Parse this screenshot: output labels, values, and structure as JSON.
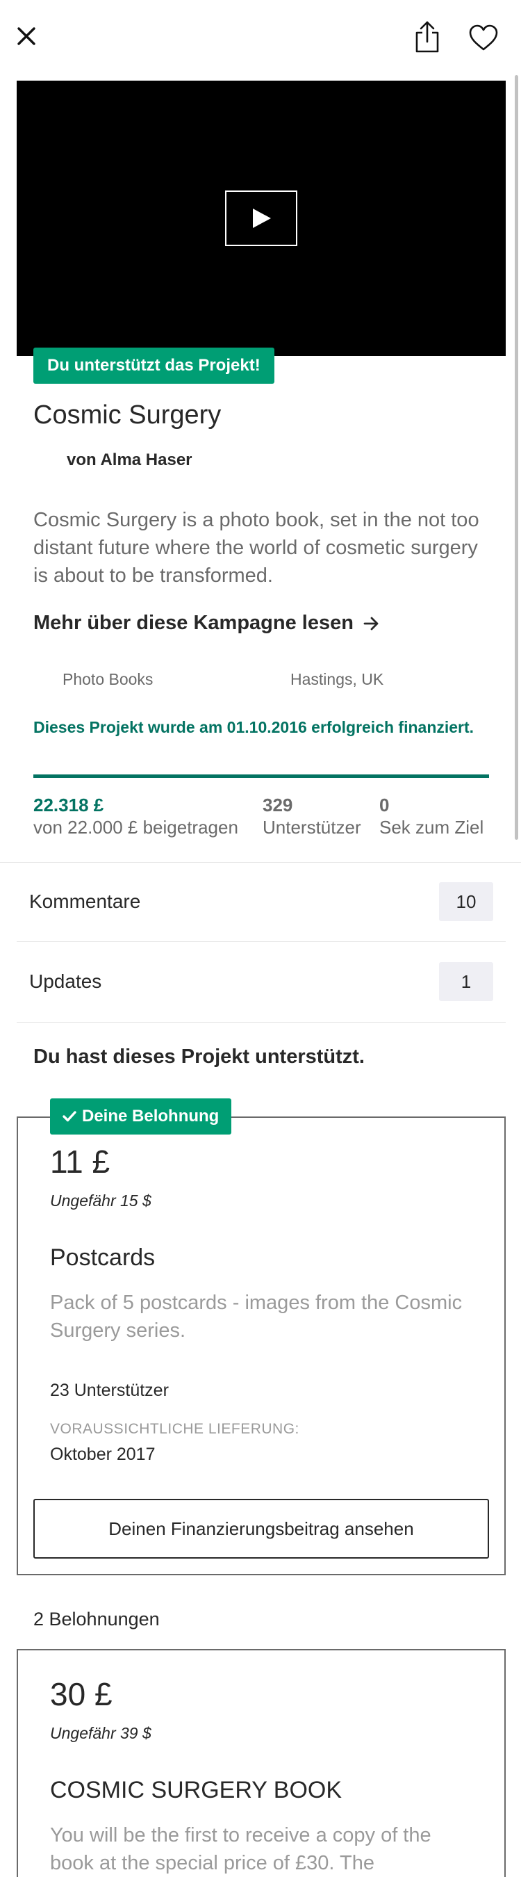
{
  "project": {
    "backed_badge": "Du unterstützt das Projekt!",
    "title": "Cosmic Surgery",
    "creator": "von Alma Haser",
    "blurb": "Cosmic Surgery is a photo book, set in the not too distant future where the world of cosmetic surgery is about to be transformed.",
    "read_more": "Mehr über diese Kampagne lesen",
    "category": "Photo Books",
    "location": "Hastings, UK",
    "funded_message": "Dieses Projekt wurde am 01.10.2016 erfolgreich finanziert.",
    "progress_fraction": 1.0,
    "stats": {
      "pledged_value": "22.318 £",
      "pledged_label": "von 22.000 £ beigetragen",
      "backers_value": "329",
      "backers_label": "Unterstützer",
      "time_value": "0",
      "time_label": "Sek zum Ziel"
    }
  },
  "nav": {
    "comments_label": "Kommentare",
    "comments_count": "10",
    "updates_label": "Updates",
    "updates_count": "1"
  },
  "backed_section": {
    "heading": "Du hast dieses Projekt unterstützt.",
    "badge": "Deine Belohnung",
    "reward": {
      "price": "11 £",
      "approx": "Ungefähr 15 $",
      "title": "Postcards",
      "description": "Pack of 5 postcards - images from the Cosmic Surgery series.",
      "backers": "23 Unterstützer",
      "estimated_label": "VORAUSSICHTLICHE LIEFERUNG:",
      "estimated_value": "Oktober 2017"
    },
    "view_pledge_button": "Deinen Finanzierungsbeitrag ansehen"
  },
  "rewards": {
    "count_label": "2 Belohnungen",
    "items": [
      {
        "price": "30 £",
        "approx": "Ungefähr 39 $",
        "title": "COSMIC SURGERY BOOK",
        "description": "You will be the first to receive a copy of the book at the special price of £30. The"
      }
    ]
  },
  "colors": {
    "accent_green": "#009e74",
    "dark_green": "#037362",
    "text_primary": "#282828",
    "text_secondary": "#6a6a6a"
  },
  "icons": [
    "close-icon",
    "share-icon",
    "heart-icon",
    "play-icon",
    "arrow-right-icon",
    "checkmark-icon"
  ]
}
